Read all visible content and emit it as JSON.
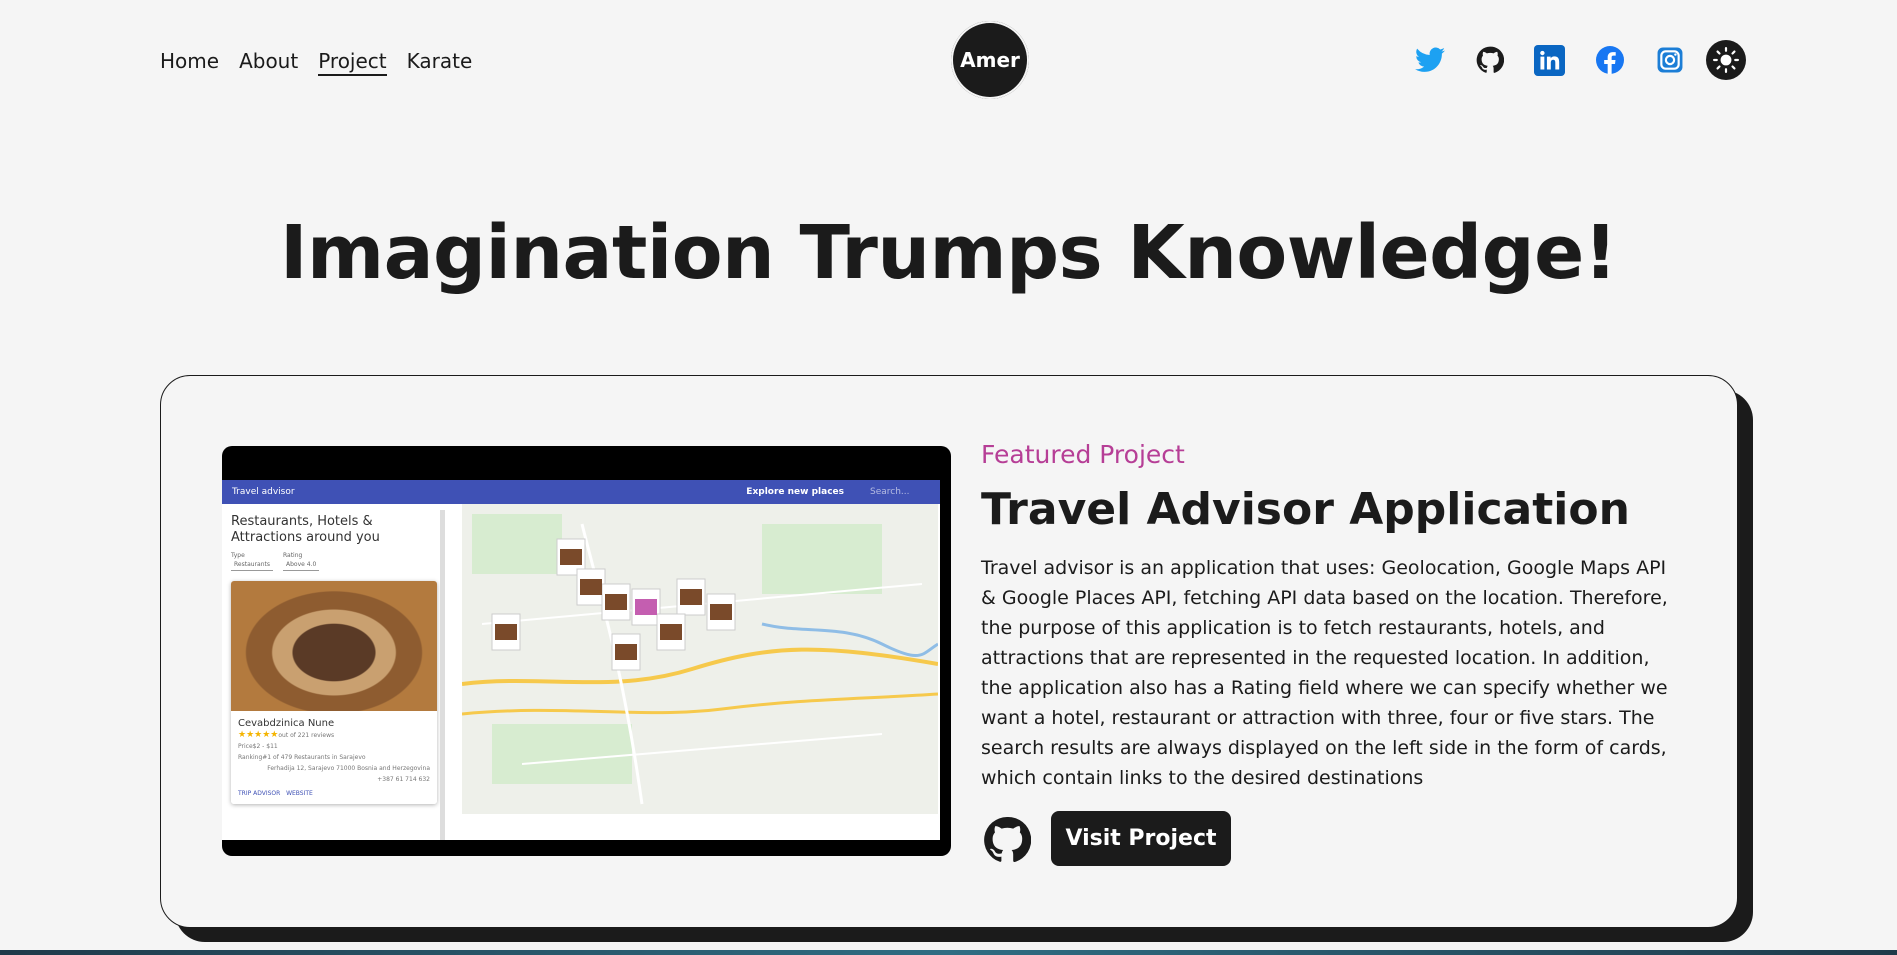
{
  "nav": {
    "links": [
      "Home",
      "About",
      "Project",
      "Karate"
    ],
    "active": "Project",
    "logo": "Amer"
  },
  "socials": [
    "twitter-icon",
    "github-icon",
    "linkedin-icon",
    "facebook-icon",
    "instagram-icon"
  ],
  "colors": {
    "background": "#f5f5f5",
    "dark": "#1b1b1b",
    "accent": "#b63e96",
    "twitter": "#1da1f2",
    "linkedin": "#0a66c2",
    "facebook": "#1877f2",
    "instagram": "#1c7ed6"
  },
  "headline": "Imagination Trumps Knowledge!",
  "project": {
    "label": "Featured Project",
    "title": "Travel Advisor Application",
    "description": "Travel advisor is an application that uses: Geolocation, Google Maps API & Google Places API, fetching API data based on the location. Therefore, the purpose of this application is to fetch restaurants, hotels, and attractions that are represented in the requested location. In addition, the application also has a Rating field where we can specify whether we want a hotel, restaurant or attraction with three, four or five stars. The search results are always displayed on the left side in the form of cards, which contain links to the desired destinations",
    "visit_label": "Visit Project",
    "screenshot": {
      "app_title": "Travel advisor",
      "explore": "Explore new places",
      "search_placeholder": "Search...",
      "heading": "Restaurants, Hotels & Attractions around you",
      "type_label": "Type",
      "type_value": "Restaurants",
      "rating_label": "Rating",
      "rating_value": "Above 4.0",
      "place_name": "Cevabdzinica Nune",
      "reviews": "out of 221 reviews",
      "price": "Price$2 - $11",
      "ranking": "Ranking#1 of 479 Restaurants in Sarajevo",
      "address": "Ferhadija 12, Sarajevo 71000 Bosnia and Herzegovina",
      "phone": "+387 61 714 632",
      "link1": "TRIP ADVISOR",
      "link2": "WEBSITE"
    }
  }
}
